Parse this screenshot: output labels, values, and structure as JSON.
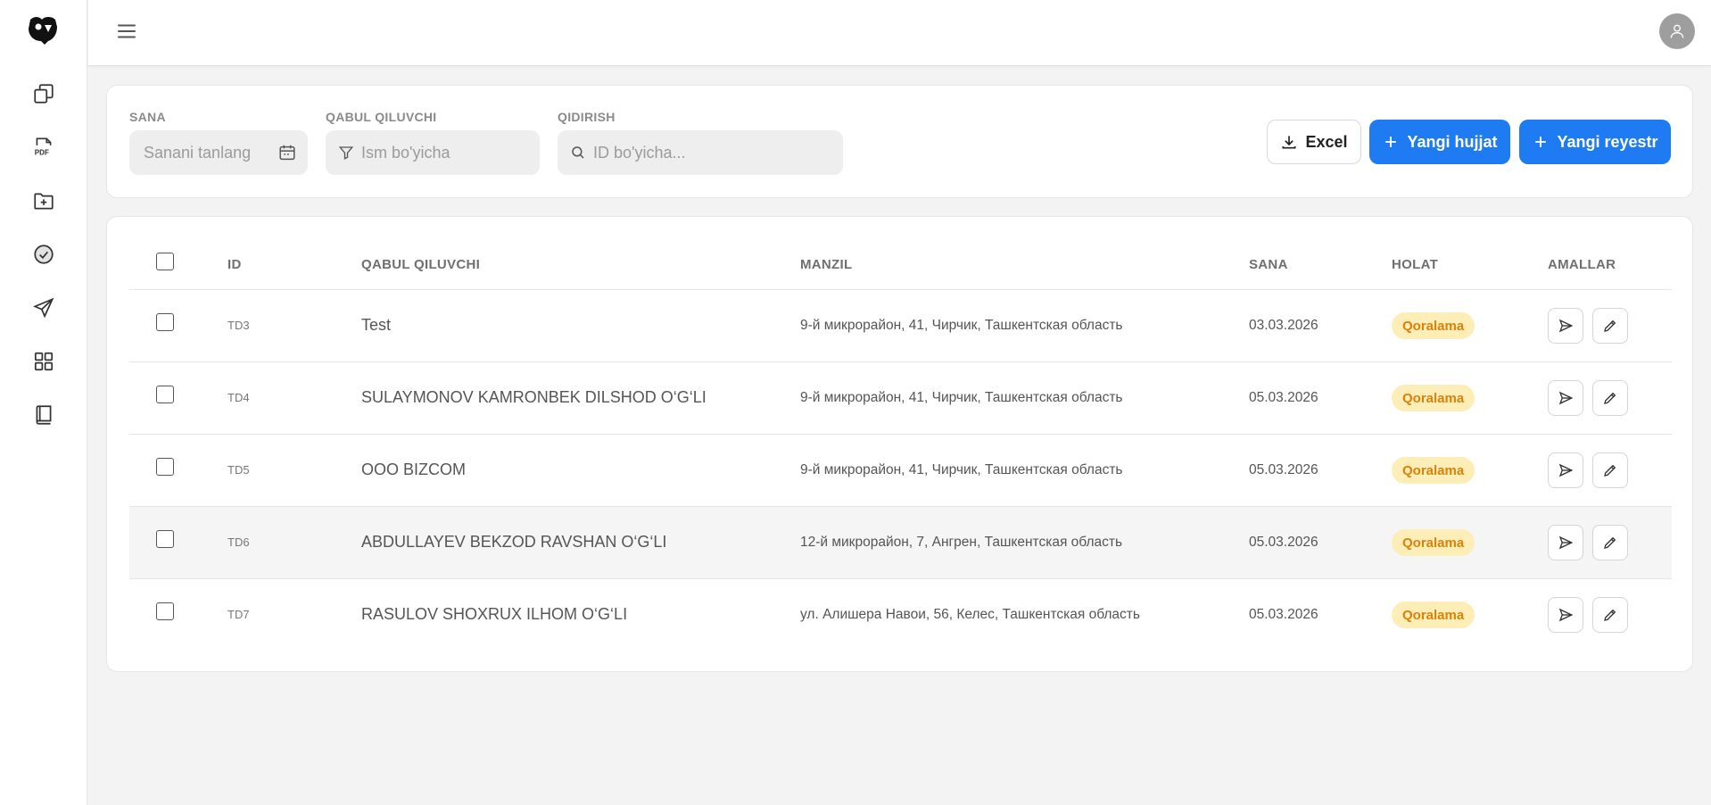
{
  "filters": {
    "date": {
      "label": "SANA",
      "placeholder": "Sanani tanlang"
    },
    "recipient": {
      "label": "QABUL QILUVCHI",
      "placeholder": "Ism bo'yicha"
    },
    "search": {
      "label": "QIDIRISH",
      "placeholder": "ID bo'yicha..."
    }
  },
  "actions": {
    "excel": "Excel",
    "new_document": "Yangi hujjat",
    "new_registry": "Yangi reyestr"
  },
  "table": {
    "headers": {
      "id": "ID",
      "recipient": "QABUL QILUVCHI",
      "address": "MANZIL",
      "date": "SANA",
      "status": "HOLAT",
      "actions": "AMALLAR"
    },
    "rows": [
      {
        "id": "TD3",
        "recipient": "Test",
        "address": "9-й микрорайон, 41, Чирчик, Ташкентская область",
        "date": "03.03.2026",
        "status": "Qoralama"
      },
      {
        "id": "TD4",
        "recipient": "SULAYMONOV KAMRONBEK DILSHOD O‘G‘LI",
        "address": "9-й микрорайон, 41, Чирчик, Ташкентская область",
        "date": "05.03.2026",
        "status": "Qoralama"
      },
      {
        "id": "TD5",
        "recipient": "OOO BIZCOM",
        "address": "9-й микрорайон, 41, Чирчик, Ташкентская область",
        "date": "05.03.2026",
        "status": "Qoralama"
      },
      {
        "id": "TD6",
        "recipient": "ABDULLAYEV BEKZOD RAVSHAN O‘G‘LI",
        "address": "12-й микрорайон, 7, Ангрен, Ташкентская область",
        "date": "05.03.2026",
        "status": "Qoralama"
      },
      {
        "id": "TD7",
        "recipient": "RASULOV SHOXRUX ILHOM O‘G‘LI",
        "address": "ул. Алишера Навои, 56, Келес, Ташкентская область",
        "date": "05.03.2026",
        "status": "Qoralama"
      }
    ]
  },
  "colors": {
    "primary": "#1e7bf2",
    "badge_bg": "#fdeeb8",
    "badge_text": "#d9820a"
  },
  "icons": [
    "logo",
    "copy-icon",
    "pdf-icon",
    "folder-plus-icon",
    "check-circle-icon",
    "send-icon",
    "grid-icon",
    "book-icon",
    "menu-icon",
    "user-icon",
    "calendar-icon",
    "filter-icon",
    "search-icon",
    "download-icon",
    "plus-icon",
    "edit-icon"
  ]
}
